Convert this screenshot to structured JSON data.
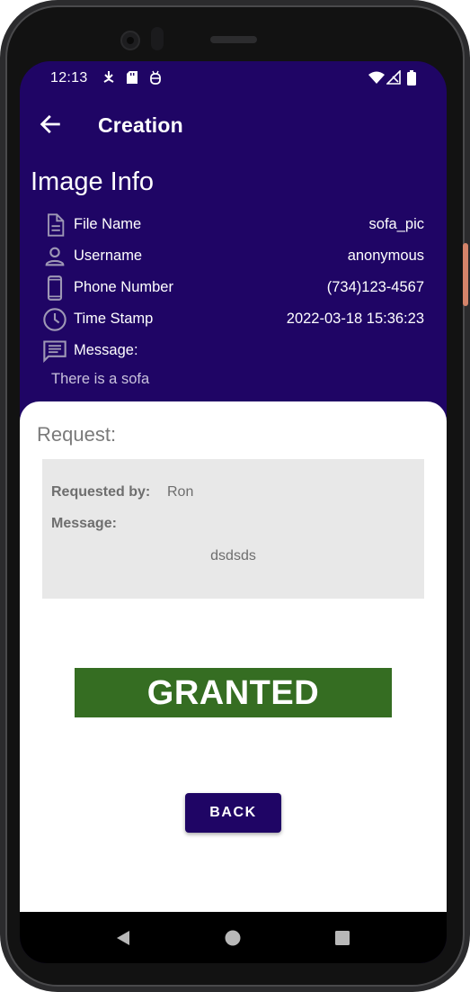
{
  "status_bar": {
    "time": "12:13",
    "left_icons": [
      "download-icon",
      "sd-card-icon",
      "android-debug-icon"
    ],
    "right_icons": [
      "wifi-icon",
      "no-signal-icon",
      "battery-icon"
    ]
  },
  "app_bar": {
    "title": "Creation",
    "back_icon": "arrow-back-icon"
  },
  "image_info": {
    "heading": "Image Info",
    "rows": [
      {
        "icon": "file-icon",
        "label": "File Name",
        "value": "sofa_pic"
      },
      {
        "icon": "person-icon",
        "label": "Username",
        "value": "anonymous"
      },
      {
        "icon": "phone-icon",
        "label": "Phone Number",
        "value": "(734)123-4567"
      },
      {
        "icon": "clock-icon",
        "label": "Time Stamp",
        "value": "2022-03-18 15:36:23"
      },
      {
        "icon": "message-icon",
        "label": "Message:"
      }
    ],
    "message": "There is a sofa"
  },
  "request": {
    "heading": "Request:",
    "requested_by_label": "Requested by:",
    "requested_by_value": "Ron",
    "message_label": "Message:",
    "message_value": "dsdsds"
  },
  "status_banner": "GRANTED",
  "back_button": "BACK",
  "nav_bar": [
    "back-triangle-icon",
    "home-circle-icon",
    "recents-square-icon"
  ],
  "colors": {
    "app_primary": "#1f0565",
    "granted_green": "#356d22",
    "request_box": "#e8e8e8"
  }
}
